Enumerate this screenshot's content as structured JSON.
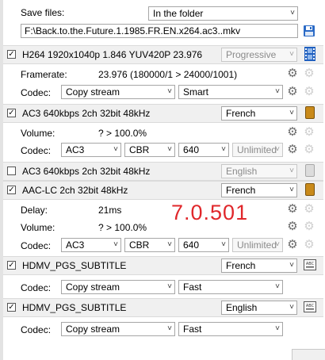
{
  "save": {
    "label": "Save files:",
    "mode": "In the folder",
    "path": "F:\\Back.to.the.Future.1.1985.FR.EN.x264.ac3..mkv"
  },
  "version": "7.0.501",
  "video": {
    "title": "H264 1920x1040p 1.846 YUV420P 23.976",
    "checked": true,
    "scan": "Progressive",
    "framerate_label": "Framerate:",
    "framerate_value": "23.976 (180000/1 > 24000/1001)",
    "codec_label": "Codec:",
    "codec": "Copy stream",
    "mode": "Smart"
  },
  "audio1": {
    "title": "AC3 640kbps 2ch 32bit 48kHz",
    "checked": true,
    "language": "French",
    "volume_label": "Volume:",
    "volume_value": "? > 100.0%",
    "codec_label": "Codec:",
    "codec": "AC3",
    "rate_mode": "CBR",
    "bitrate": "640",
    "limit": "Unlimited"
  },
  "audio2": {
    "title": "AC3 640kbps 2ch 32bit 48kHz",
    "checked": false,
    "language": "English"
  },
  "audio3": {
    "title": "AAC-LC 2ch 32bit 48kHz",
    "checked": true,
    "language": "French",
    "delay_label": "Delay:",
    "delay_value": "21ms",
    "volume_label": "Volume:",
    "volume_value": "? > 100.0%",
    "codec_label": "Codec:",
    "codec": "AC3",
    "rate_mode": "CBR",
    "bitrate": "640",
    "limit": "Unlimited"
  },
  "sub1": {
    "title": "HDMV_PGS_SUBTITLE",
    "checked": true,
    "language": "French",
    "codec_label": "Codec:",
    "codec": "Copy stream",
    "mode": "Fast"
  },
  "sub2": {
    "title": "HDMV_PGS_SUBTITLE",
    "checked": true,
    "language": "English",
    "codec_label": "Codec:",
    "codec": "Copy stream",
    "mode": "Fast"
  },
  "icons": {
    "check": "✓",
    "dropdown": "˅",
    "gear": "⚙"
  },
  "colors": {
    "version": "#e0272b",
    "film": "#1f5fbf",
    "audio": "#c98a1a",
    "subtitle": "#555555"
  }
}
